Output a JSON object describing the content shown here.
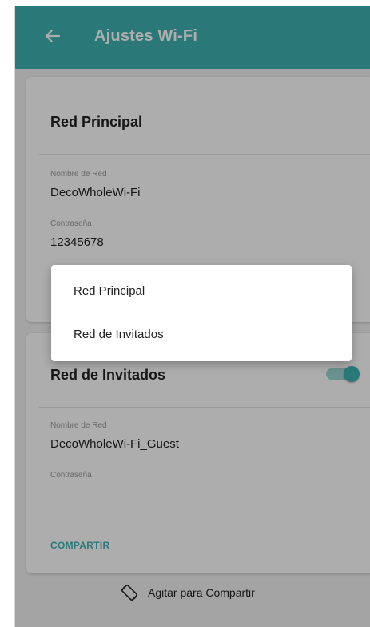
{
  "appbar": {
    "title": "Ajustes Wi-Fi",
    "back_icon": "arrow-left-icon",
    "color": "#3fb3b2"
  },
  "main_network": {
    "title": "Red Principal",
    "name_label": "Nombre de Red",
    "name_value": "DecoWholeWi-Fi",
    "password_label": "Contraseña",
    "password_value": "12345678"
  },
  "guest_network": {
    "title": "Red de Invitados",
    "toggle_on": true,
    "name_label": "Nombre de Red",
    "name_value": "DecoWholeWi-Fi_Guest",
    "password_label": "Contraseña",
    "password_value": "",
    "share_label": "COMPARTIR"
  },
  "shake": {
    "icon": "phone-rotate-icon",
    "label": "Agitar para Compartir"
  },
  "popup_menu": {
    "items": [
      {
        "label": "Red Principal"
      },
      {
        "label": "Red de Invitados"
      }
    ]
  }
}
